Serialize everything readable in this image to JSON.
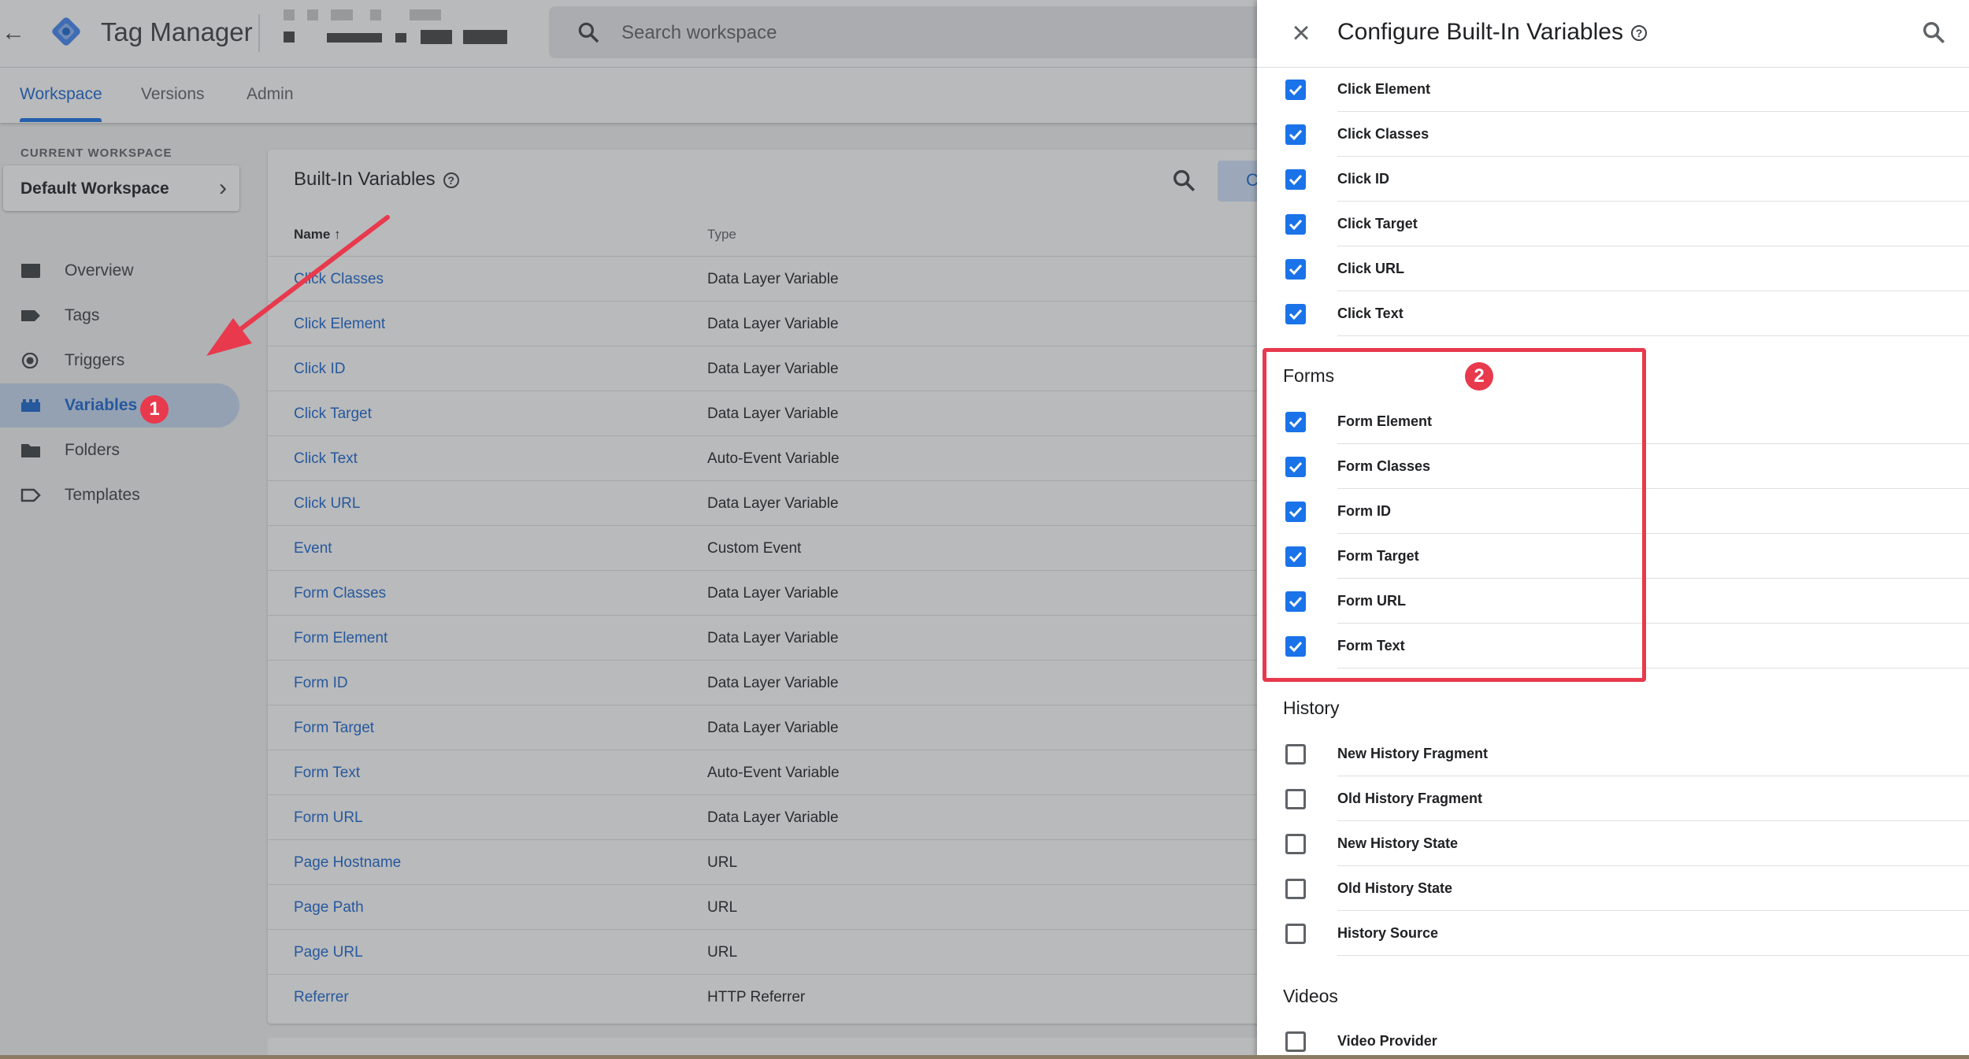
{
  "app": {
    "title": "Tag Manager",
    "search_placeholder": "Search workspace"
  },
  "tabs": [
    {
      "label": "Workspace",
      "active": true
    },
    {
      "label": "Versions",
      "active": false
    },
    {
      "label": "Admin",
      "active": false
    }
  ],
  "sidebar": {
    "current_workspace_label": "CURRENT WORKSPACE",
    "workspace_name": "Default Workspace",
    "items": [
      {
        "label": "Overview",
        "icon": "overview-icon"
      },
      {
        "label": "Tags",
        "icon": "tag-icon"
      },
      {
        "label": "Triggers",
        "icon": "trigger-icon"
      },
      {
        "label": "Variables",
        "icon": "variables-icon",
        "active": true
      },
      {
        "label": "Folders",
        "icon": "folder-icon"
      },
      {
        "label": "Templates",
        "icon": "template-icon"
      }
    ]
  },
  "builtin": {
    "title": "Built-In Variables",
    "configure_label": "C",
    "col_name": "Name ↑",
    "col_type": "Type",
    "rows": [
      {
        "name": "Click Classes",
        "type": "Data Layer Variable"
      },
      {
        "name": "Click Element",
        "type": "Data Layer Variable"
      },
      {
        "name": "Click ID",
        "type": "Data Layer Variable"
      },
      {
        "name": "Click Target",
        "type": "Data Layer Variable"
      },
      {
        "name": "Click Text",
        "type": "Auto-Event Variable"
      },
      {
        "name": "Click URL",
        "type": "Data Layer Variable"
      },
      {
        "name": "Event",
        "type": "Custom Event"
      },
      {
        "name": "Form Classes",
        "type": "Data Layer Variable"
      },
      {
        "name": "Form Element",
        "type": "Data Layer Variable"
      },
      {
        "name": "Form ID",
        "type": "Data Layer Variable"
      },
      {
        "name": "Form Target",
        "type": "Data Layer Variable"
      },
      {
        "name": "Form Text",
        "type": "Auto-Event Variable"
      },
      {
        "name": "Form URL",
        "type": "Data Layer Variable"
      },
      {
        "name": "Page Hostname",
        "type": "URL"
      },
      {
        "name": "Page Path",
        "type": "URL"
      },
      {
        "name": "Page URL",
        "type": "URL"
      },
      {
        "name": "Referrer",
        "type": "HTTP Referrer"
      }
    ]
  },
  "panel": {
    "title": "Configure Built-In Variables",
    "clicks": [
      {
        "label": "Click Element",
        "checked": true
      },
      {
        "label": "Click Classes",
        "checked": true
      },
      {
        "label": "Click ID",
        "checked": true
      },
      {
        "label": "Click Target",
        "checked": true
      },
      {
        "label": "Click URL",
        "checked": true
      },
      {
        "label": "Click Text",
        "checked": true
      }
    ],
    "forms_title": "Forms",
    "forms": [
      {
        "label": "Form Element",
        "checked": true
      },
      {
        "label": "Form Classes",
        "checked": true
      },
      {
        "label": "Form ID",
        "checked": true
      },
      {
        "label": "Form Target",
        "checked": true
      },
      {
        "label": "Form URL",
        "checked": true
      },
      {
        "label": "Form Text",
        "checked": true
      }
    ],
    "history_title": "History",
    "history": [
      {
        "label": "New History Fragment",
        "checked": false
      },
      {
        "label": "Old History Fragment",
        "checked": false
      },
      {
        "label": "New History State",
        "checked": false
      },
      {
        "label": "Old History State",
        "checked": false
      },
      {
        "label": "History Source",
        "checked": false
      }
    ],
    "videos_title": "Videos",
    "videos": [
      {
        "label": "Video Provider",
        "checked": false
      }
    ]
  },
  "annotations": {
    "badge1": "1",
    "badge2": "2",
    "color": "#e8394d"
  }
}
